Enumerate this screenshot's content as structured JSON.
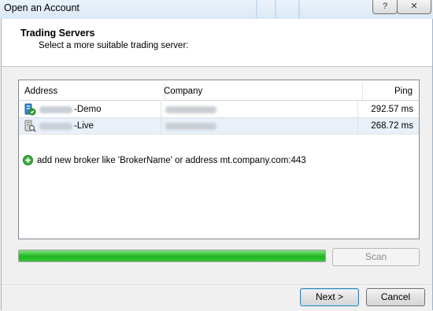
{
  "window": {
    "title": "Open an Account",
    "help_label": "?",
    "close_label": "✕"
  },
  "header": {
    "title": "Trading Servers",
    "subtitle": "Select a more suitable trading server:"
  },
  "servers": {
    "columns": [
      "Address",
      "Company",
      "Ping"
    ],
    "rows": [
      {
        "address_suffix": "-Demo",
        "ping": "292.57 ms",
        "icon": "server-demo-icon",
        "selected": false
      },
      {
        "address_suffix": "-Live",
        "ping": "268.72 ms",
        "icon": "server-live-icon",
        "selected": true
      }
    ],
    "add_broker_text": "add new broker like 'BrokerName' or address mt.company.com:443"
  },
  "scan": {
    "progress": 1.0,
    "button_label": "Scan",
    "button_enabled": false
  },
  "footer": {
    "next_label": "Next >",
    "cancel_label": "Cancel"
  },
  "colors": {
    "progress_green": "#21b621",
    "selected_row": "#e9f0f8",
    "default_button_border": "#3c7fb1"
  }
}
